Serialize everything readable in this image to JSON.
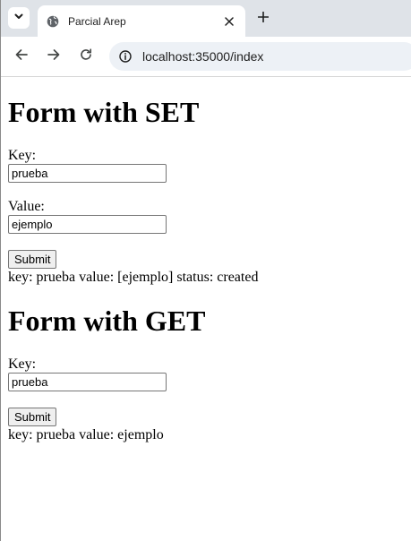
{
  "browser": {
    "tab_title": "Parcial Arep",
    "url": "localhost:35000/index"
  },
  "set_form": {
    "heading": "Form with SET",
    "key_label": "Key:",
    "key_value": "prueba",
    "value_label": "Value:",
    "value_value": "ejemplo",
    "submit_label": "Submit",
    "result": "key: prueba value: [ejemplo] status: created"
  },
  "get_form": {
    "heading": "Form with GET",
    "key_label": "Key:",
    "key_value": "prueba",
    "submit_label": "Submit",
    "result": "key: prueba value: ejemplo"
  },
  "icons": {
    "tab_search": "chevron-down-icon",
    "favicon": "globe-icon",
    "close": "close-icon",
    "new_tab": "plus-icon",
    "back": "back-arrow-icon",
    "forward": "forward-arrow-icon",
    "reload": "reload-icon",
    "site_info": "info-icon"
  }
}
